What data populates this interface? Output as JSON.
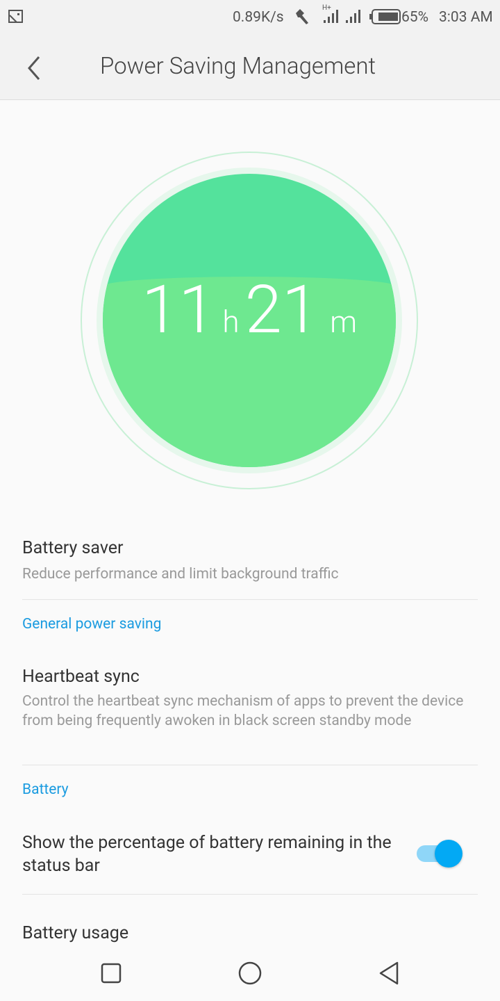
{
  "status_bar": {
    "speed": "0.89K/s",
    "network": "H+",
    "battery_percent": "65%",
    "time": "3:03 AM"
  },
  "header": {
    "title": "Power Saving Management"
  },
  "gauge": {
    "hours": "11",
    "hours_unit": "h",
    "minutes": "21",
    "minutes_unit": "m",
    "fill_percent": 65,
    "color": "#6ee890"
  },
  "items": {
    "battery_saver": {
      "title": "Battery saver",
      "subtitle": "Reduce performance and limit background traffic"
    },
    "section_general": "General power saving",
    "heartbeat": {
      "title": "Heartbeat sync",
      "subtitle": "Control the heartbeat sync mechanism of apps to prevent the device from being frequently awoken in black screen standby mode"
    },
    "section_battery": "Battery",
    "show_percentage": {
      "title": "Show the percentage of battery remaining in the status bar",
      "enabled": true
    },
    "battery_usage": {
      "title": "Battery usage"
    }
  },
  "colors": {
    "accent": "#1a9be0",
    "toggle": "#03a9f4"
  }
}
